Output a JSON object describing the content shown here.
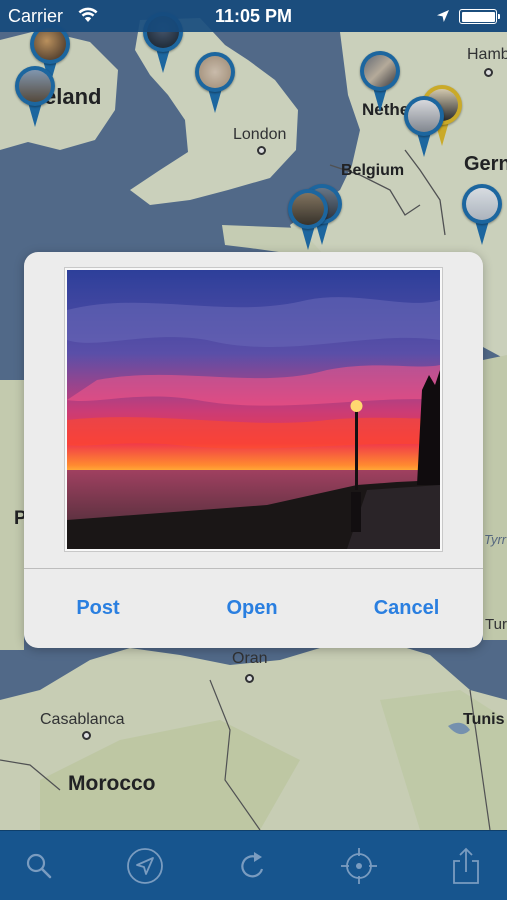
{
  "status_bar": {
    "carrier": "Carrier",
    "time": "11:05 PM",
    "icons": [
      "wifi-icon",
      "location-arrow-icon",
      "battery-icon"
    ]
  },
  "map": {
    "places": {
      "ireland": "eland",
      "belgium": "Belgium",
      "netherlands": "Nethe",
      "germany": "Gern",
      "morocco": "Morocco",
      "portugal_fragment": "P",
      "tunisia": "Tunis",
      "tyrrhenian": "Tyrr",
      "tunisia_sea_fragment": "Tur"
    },
    "cities": {
      "london": "London",
      "hamburg": "Hamb",
      "oran": "Oran",
      "casablanca": "Casablanca"
    },
    "colors": {
      "land": "#d9dfc6",
      "sea": "#566f8f",
      "pin": "#1d6ca8",
      "pin_highlight": "#d9b628"
    }
  },
  "dialog": {
    "buttons": {
      "post": "Post",
      "open": "Open",
      "cancel": "Cancel"
    },
    "accent": "#2a7fe0"
  },
  "toolbar": {
    "icons": [
      "search-icon",
      "navigation-arrow-icon",
      "refresh-icon",
      "crosshair-locate-icon",
      "share-icon"
    ],
    "color": "#17558e"
  }
}
